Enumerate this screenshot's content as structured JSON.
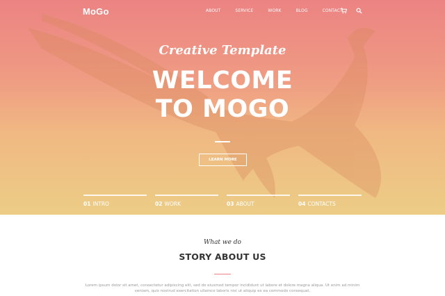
{
  "brand": {
    "logo": "MoGo"
  },
  "nav": {
    "items": [
      "About",
      "Service",
      "Work",
      "Blog",
      "Contact"
    ],
    "icons": [
      "cart-icon",
      "search-icon"
    ]
  },
  "hero": {
    "subtitle": "Creative Template",
    "title_line1": "WELCOME",
    "title_line2": "TO MOGO",
    "button_label": "LEARN MORE",
    "slides": [
      {
        "num": "01",
        "label": "INTRO"
      },
      {
        "num": "02",
        "label": "WORK"
      },
      {
        "num": "03",
        "label": "ABOUT"
      },
      {
        "num": "04",
        "label": "CONTACTS"
      }
    ],
    "gradient_top": "#ec8383",
    "gradient_bottom": "#eccd86"
  },
  "about": {
    "kicker": "What we do",
    "title": "STORY ABOUT US",
    "text": "Lorem ipsum dolor sit amet, consectetur adipiscing elit, sed do eiusmod tempor incididunt ut labore et dolore magna aliqua. Ut enim ad minim veniam, quis nostrud exercitation ullamco laboris nisi ut aliquip ex ea commodo consequat.",
    "accent": "#f38181"
  }
}
